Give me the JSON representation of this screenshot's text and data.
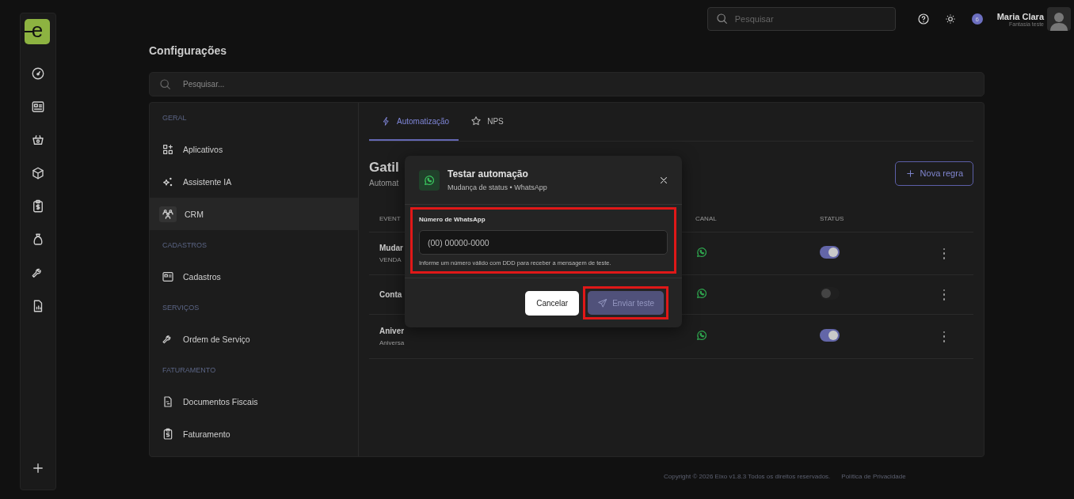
{
  "logo": "e",
  "topbar": {
    "search": {
      "placeholder": "Pesquisar"
    },
    "notification_badge": "6",
    "user": {
      "name": "Maria Clara",
      "subtitle": "Fantasia teste"
    }
  },
  "page_title": "Configurações",
  "search": {
    "placeholder": "Pesquisar..."
  },
  "settings_menu": [
    {
      "kind": "section",
      "label": "GERAL"
    },
    {
      "kind": "item",
      "label": "Aplicativos",
      "selected": false
    },
    {
      "kind": "item",
      "label": "Assistente IA",
      "selected": false
    },
    {
      "kind": "item",
      "label": "CRM",
      "selected": true
    },
    {
      "kind": "section",
      "label": "CADASTROS"
    },
    {
      "kind": "item",
      "label": "Cadastros",
      "selected": false
    },
    {
      "kind": "section",
      "label": "SERVIÇOS"
    },
    {
      "kind": "item",
      "label": "Ordem de Serviço",
      "selected": false
    },
    {
      "kind": "section",
      "label": "FATURAMENTO"
    },
    {
      "kind": "item",
      "label": "Documentos Fiscais",
      "selected": false
    },
    {
      "kind": "item",
      "label": "Faturamento",
      "selected": false
    }
  ],
  "tabs": [
    {
      "label": "Automatização",
      "selected": true
    },
    {
      "label": "NPS",
      "selected": false
    }
  ],
  "section": {
    "title": "Gatil",
    "subtitle": "Automat",
    "new_rule_button": "Nova regra"
  },
  "table": {
    "columns": [
      "EVENT",
      "CANAL",
      "STATUS"
    ],
    "rows": [
      {
        "title": "Mudar",
        "subtitle": "VENDA",
        "on": true
      },
      {
        "title": "Conta",
        "on": false
      },
      {
        "title": "Aniver",
        "subtitle": "Aniversa",
        "on": true
      }
    ]
  },
  "modal": {
    "title": "Testar automação",
    "subtitle": "Mudança de status • WhatsApp",
    "field": {
      "label": "Número de WhatsApp",
      "placeholder": "(00) 00000-0000",
      "hint": "Informe um número válido com DDD para receber a mensagem de teste.",
      "highlighted": true
    },
    "cancel": "Cancelar",
    "send": {
      "label": "Enviar teste",
      "disabled": true,
      "highlighted": true
    }
  },
  "footer": {
    "copyright": "Copyright © 2026 Eixo v1.8.3 Todos os direitos reservados.",
    "privacy": "Política de Privacidade"
  }
}
